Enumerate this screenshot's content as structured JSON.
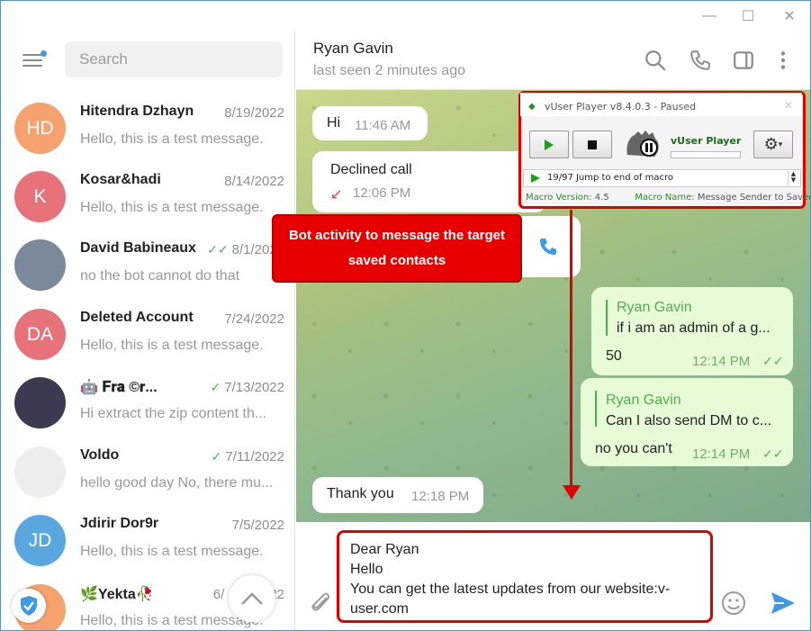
{
  "window": {
    "minimize": "—",
    "maximize": "☐",
    "close": "✕"
  },
  "sidebar": {
    "search_placeholder": "Search",
    "chats": [
      {
        "initials": "HD",
        "color": "#f5a26f",
        "name": "Hitendra Dzhayn",
        "date": "8/19/2022",
        "check": "",
        "preview": "Hello, this is a test message."
      },
      {
        "initials": "K",
        "color": "#e7737a",
        "name": "Kosar&hadi",
        "date": "8/14/2022",
        "check": "",
        "preview": "Hello, this is a test message."
      },
      {
        "initials": "",
        "color": "#7a8a9a",
        "name": "David Babineaux",
        "date": "8/1/2022",
        "check": "✓✓",
        "preview": "no the bot cannot do that"
      },
      {
        "initials": "DA",
        "color": "#e7737a",
        "name": "Deleted Account",
        "date": "7/24/2022",
        "check": "",
        "preview": "Hello, this is a test message."
      },
      {
        "initials": "",
        "color": "#3a3a50",
        "name": "🤖 𝐅𝐫𝐚 ©𝐫...",
        "date": "7/13/2022",
        "check": "✓",
        "preview": "Hi extract the zip content th..."
      },
      {
        "initials": "",
        "color": "#eeeeee",
        "name": "Voldo",
        "date": "7/11/2022",
        "check": "✓",
        "preview": "hello good day No, there mu..."
      },
      {
        "initials": "JD",
        "color": "#5aa7e0",
        "name": "Jdirir Dor9r",
        "date": "7/5/2022",
        "check": "",
        "preview": "Hello, this is a test message."
      },
      {
        "initials": "",
        "color": "#f5a26f",
        "name": "🌿Yekta🥀",
        "date": "6/",
        "check": "",
        "preview": "Hello, this is a test message."
      }
    ],
    "date_tail": "22"
  },
  "header": {
    "name": "Ryan Gavin",
    "status": "last seen 2 minutes ago"
  },
  "messages": {
    "m1": {
      "text": "Hi",
      "time": "11:46 AM"
    },
    "m2": {
      "title": "Declined call",
      "time": "12:06 PM"
    },
    "m4": {
      "reply_name": "Ryan Gavin",
      "reply_text": "if i am an admin of a g...",
      "text": "50",
      "time": "12:14 PM"
    },
    "m5": {
      "reply_name": "Ryan Gavin",
      "reply_text": "Can I also send DM to c...",
      "text": "no you can't",
      "time": "12:14 PM"
    },
    "m6": {
      "text": "Thank you",
      "time": "12:18 PM"
    },
    "ticks": "✓✓"
  },
  "vuser": {
    "title": "vUser Player v8.4.0.3 - Paused",
    "label": "vUser Player",
    "step": "19/97 Jump to end of macro",
    "version_label": "Macro Version:",
    "version": "4.5",
    "name_label": "Macro Name:",
    "name": "Message Sender to Saved C"
  },
  "callout": {
    "text": "Bot activity to message the target saved contacts"
  },
  "composer": {
    "lines": [
      "Dear Ryan",
      "Hello",
      "You can get the latest updates from our website:v-",
      "user.com"
    ]
  }
}
